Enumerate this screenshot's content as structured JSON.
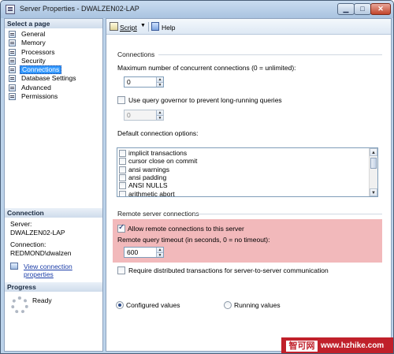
{
  "window": {
    "title": "Server Properties - DWALZEN02-LAP",
    "min_glyph": "▁",
    "max_glyph": "□",
    "close_glyph": "✕"
  },
  "left": {
    "select_header": "Select a page",
    "pages": [
      {
        "label": "General",
        "selected": false
      },
      {
        "label": "Memory",
        "selected": false
      },
      {
        "label": "Processors",
        "selected": false
      },
      {
        "label": "Security",
        "selected": false
      },
      {
        "label": "Connections",
        "selected": true
      },
      {
        "label": "Database Settings",
        "selected": false
      },
      {
        "label": "Advanced",
        "selected": false
      },
      {
        "label": "Permissions",
        "selected": false
      }
    ],
    "connection_header": "Connection",
    "server_label": "Server:",
    "server_value": "DWALZEN02-LAP",
    "connection_label": "Connection:",
    "connection_value": "REDMOND\\dwalzen",
    "view_link": "View connection properties",
    "progress_header": "Progress",
    "progress_status": "Ready"
  },
  "toolbar": {
    "script_label": "Script",
    "script_arrow": "▼",
    "help_label": "Help"
  },
  "connections": {
    "group_label": "Connections",
    "max_conn_label": "Maximum number of concurrent connections (0 = unlimited):",
    "max_conn_value": "0",
    "use_governor_label": "Use query governor to prevent long-running queries",
    "use_governor_checked": false,
    "governor_value": "0",
    "default_options_label": "Default connection options:",
    "options": [
      {
        "label": "implicit transactions",
        "checked": false
      },
      {
        "label": "cursor close on commit",
        "checked": false
      },
      {
        "label": "ansi warnings",
        "checked": false
      },
      {
        "label": "ansi padding",
        "checked": false
      },
      {
        "label": "ANSI NULLS",
        "checked": false
      },
      {
        "label": "arithmetic abort",
        "checked": false
      }
    ]
  },
  "remote": {
    "group_label": "Remote server connections",
    "allow_label": "Allow remote connections to this server",
    "allow_checked": true,
    "timeout_label": "Remote query timeout (in seconds, 0 = no timeout):",
    "timeout_value": "600",
    "require_label": "Require distributed transactions for server-to-server communication",
    "require_checked": false
  },
  "values_mode": {
    "configured_label": "Configured values",
    "running_label": "Running values",
    "selected": "configured"
  },
  "spin": {
    "up": "▲",
    "down": "▼"
  },
  "scroll": {
    "up": "▲",
    "down": "▼"
  },
  "watermark": {
    "left": "智可网",
    "right": "www.hzhike.com"
  },
  "colors": {
    "selected_page": "#3399ff",
    "remote_highlight": "#f2b9bb",
    "link": "#1c3ea8"
  }
}
